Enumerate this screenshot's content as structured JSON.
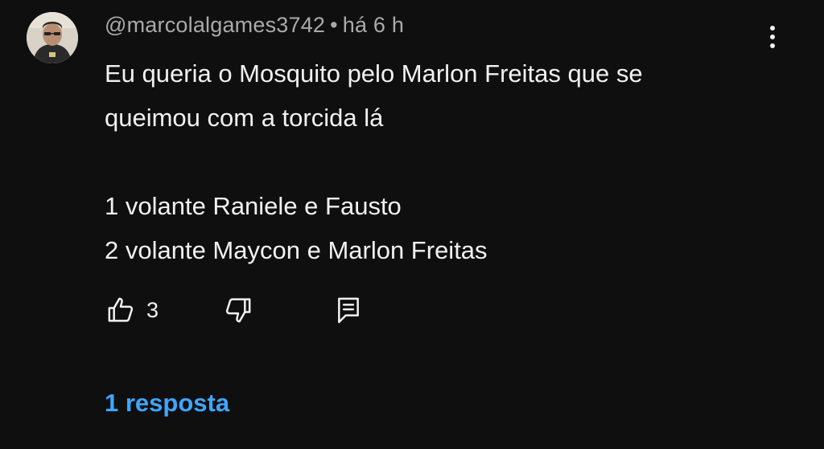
{
  "comment": {
    "author": "@marcolalgames3742",
    "separator": "•",
    "timestamp": "há 6 h",
    "lines": [
      "Eu queria o Mosquito pelo Marlon Freitas que se",
      "queimou com a torcida lá",
      "",
      "1 volante Raniele e Fausto",
      "2 volante Maycon e Marlon Freitas"
    ],
    "like_count": "3",
    "replies_label": "1 resposta"
  },
  "icons": {
    "avatar": "avatar",
    "menu": "more-vert-icon",
    "like": "thumbs-up-icon",
    "dislike": "thumbs-down-icon",
    "reply": "reply-comment-icon"
  },
  "colors": {
    "background": "#0f0f0f",
    "text": "#f1f1f1",
    "meta": "#aaaaaa",
    "link": "#3ea6ff"
  }
}
